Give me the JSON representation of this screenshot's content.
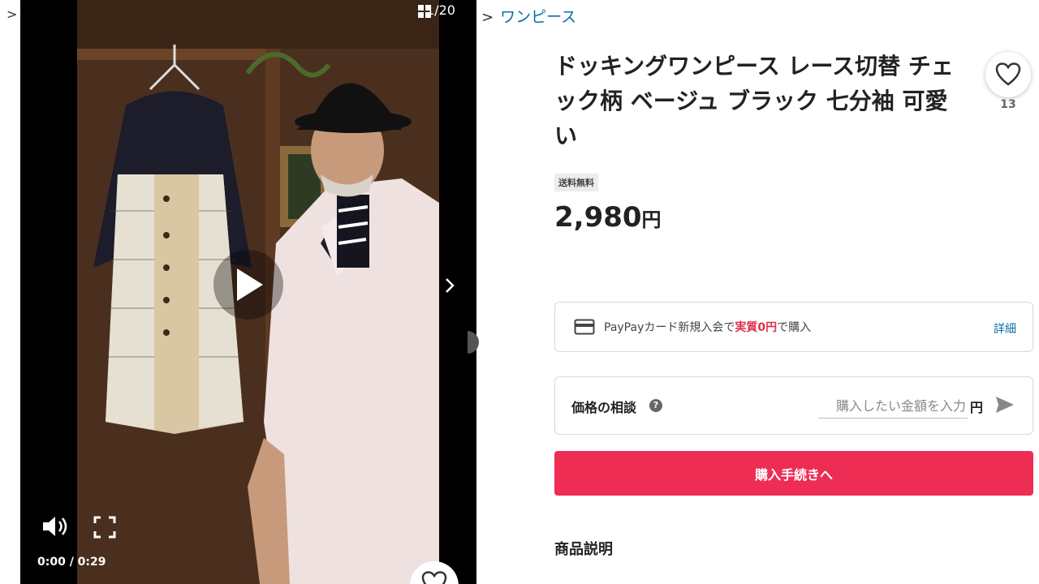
{
  "breadcrumb": {
    "left_separator": ">",
    "separator": ">",
    "category": "ワンピース"
  },
  "player": {
    "counter": "1/20",
    "time": "0:00 / 0:29"
  },
  "product": {
    "title": "ドッキングワンピース レース切替 チェック柄 ベージュ ブラック 七分袖 可愛い",
    "like_count": "13",
    "shipping_badge": "送料無料",
    "price": "2,980",
    "price_unit": "円"
  },
  "paypay": {
    "text_before": "PayPayカード新規入会で",
    "highlight": "実質0円",
    "text_after": "で購入",
    "detail_link": "詳細"
  },
  "negotiation": {
    "label": "価格の相談",
    "help": "?",
    "placeholder": "購入したい金額を入力",
    "unit": "円"
  },
  "buy_button": "購入手続きへ",
  "description_heading": "商品説明",
  "colors": {
    "accent": "#ee2d55",
    "link": "#0a6ea8"
  }
}
